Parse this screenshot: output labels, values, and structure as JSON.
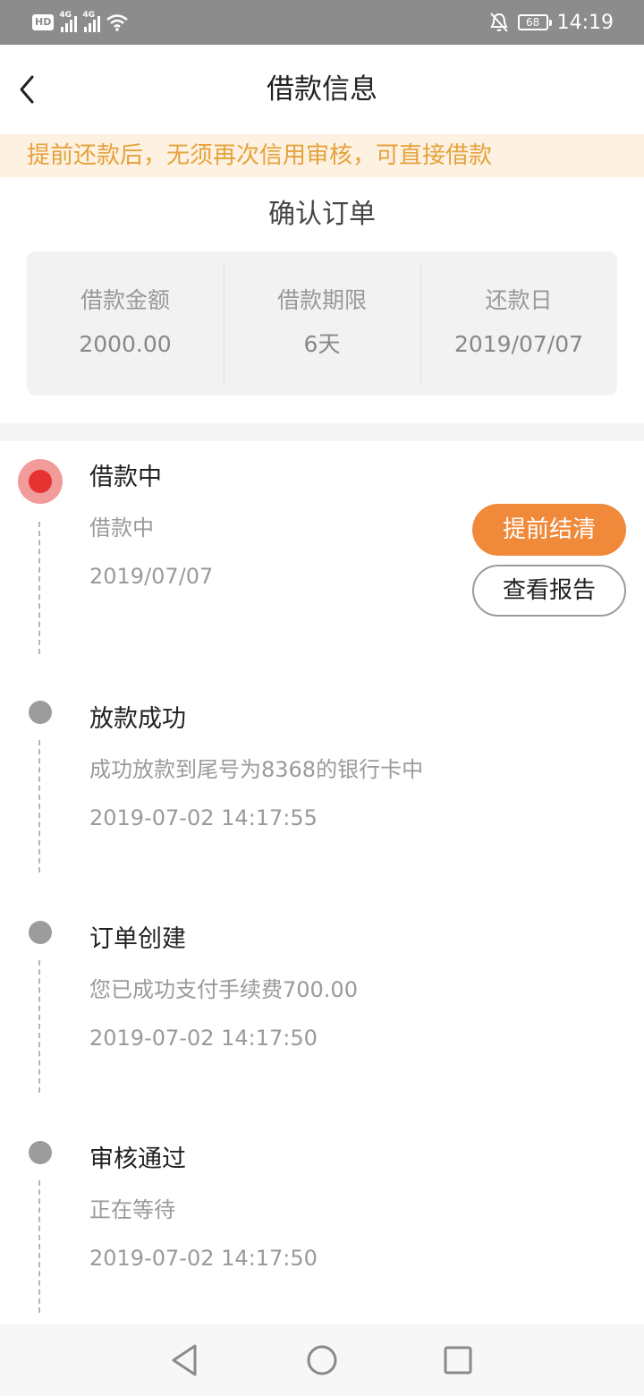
{
  "status_bar": {
    "hd": "HD",
    "sim1_tag": "4G",
    "sim2_tag": "4G",
    "battery": "68",
    "time": "14:19",
    "icons": [
      "signal-icon",
      "wifi-icon",
      "bell-muted-icon",
      "battery-icon"
    ]
  },
  "header": {
    "title": "借款信息",
    "back_icon": "back-arrow-icon"
  },
  "notice": "提前还款后，无须再次信用审核，可直接借款",
  "order": {
    "title": "确认订单",
    "summary": [
      {
        "label": "借款金额",
        "value": "2000.00"
      },
      {
        "label": "借款期限",
        "value": "6天"
      },
      {
        "label": "还款日",
        "value": "2019/07/07"
      }
    ]
  },
  "timeline": [
    {
      "title": "借款中",
      "desc": "借款中",
      "time": "2019/07/07",
      "active": true
    },
    {
      "title": "放款成功",
      "desc": "成功放款到尾号为8368的银行卡中",
      "time": "2019-07-02 14:17:55"
    },
    {
      "title": "订单创建",
      "desc": "您已成功支付手续费700.00",
      "time": "2019-07-02 14:17:50"
    },
    {
      "title": "审核通过",
      "desc": "正在等待",
      "time": "2019-07-02 14:17:50"
    }
  ],
  "actions": {
    "settle_early": "提前结清",
    "view_report": "查看报告"
  },
  "colors": {
    "accent": "#f0893a",
    "notice_text": "#e6a23c",
    "notice_bg": "#fdf1e1",
    "active_dot": "#e73232"
  },
  "nav_bar": [
    "back-triangle-icon",
    "home-circle-icon",
    "recents-square-icon"
  ]
}
